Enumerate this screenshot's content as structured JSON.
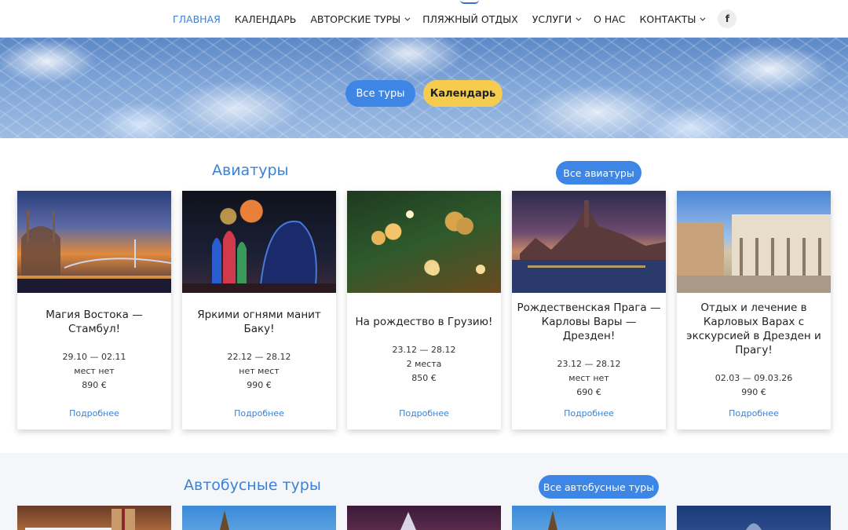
{
  "nav": {
    "items": [
      {
        "label": "ГЛАВНАЯ",
        "active": true,
        "has_dropdown": false
      },
      {
        "label": "КАЛЕНДАРЬ",
        "active": false,
        "has_dropdown": false
      },
      {
        "label": "АВТОРСКИЕ ТУРЫ",
        "active": false,
        "has_dropdown": true
      },
      {
        "label": "ПЛЯЖНЫЙ ОТДЫХ",
        "active": false,
        "has_dropdown": false
      },
      {
        "label": "УСЛУГИ",
        "active": false,
        "has_dropdown": true
      },
      {
        "label": "О НАС",
        "active": false,
        "has_dropdown": false
      },
      {
        "label": "КОНТАКТЫ",
        "active": false,
        "has_dropdown": true
      }
    ],
    "social_icon": "facebook-icon",
    "social_glyph": "f"
  },
  "hero": {
    "all_tours_label": "Все туры",
    "calendar_label": "Календарь"
  },
  "avia": {
    "title": "Авиатуры",
    "all_label": "Все авиатуры",
    "cards": [
      {
        "title": "Магия Востока — Стамбул!",
        "dates": "29.10 — 02.11",
        "seats": "мест нет",
        "price": "890 €",
        "more": "Подробнее"
      },
      {
        "title": "Яркими огнями манит Баку!",
        "dates": "22.12 — 28.12",
        "seats": "нет мест",
        "price": "990 €",
        "more": "Подробнее"
      },
      {
        "title": "На рождество в Грузию!",
        "dates": "23.12 — 28.12",
        "seats": "2 места",
        "price": "850 €",
        "more": "Подробнее"
      },
      {
        "title": "Рождественская Прага — Карловы Вары — Дрезден!",
        "dates": "23.12 — 28.12",
        "seats": "мест нет",
        "price": "690 €",
        "more": "Подробнее"
      },
      {
        "title": "Отдых и лечение в Карловых Варах с экскурсией в Дрезден и Прагу!",
        "dates": "02.03 — 09.03.26",
        "seats": "",
        "price": "990 €",
        "more": "Подробнее"
      }
    ]
  },
  "bus": {
    "title": "Автобусные туры",
    "all_label": "Все автобусные туры"
  },
  "colors": {
    "accent": "#3d86e6",
    "link": "#3a82d6",
    "yellow": "#f6cc4e"
  }
}
